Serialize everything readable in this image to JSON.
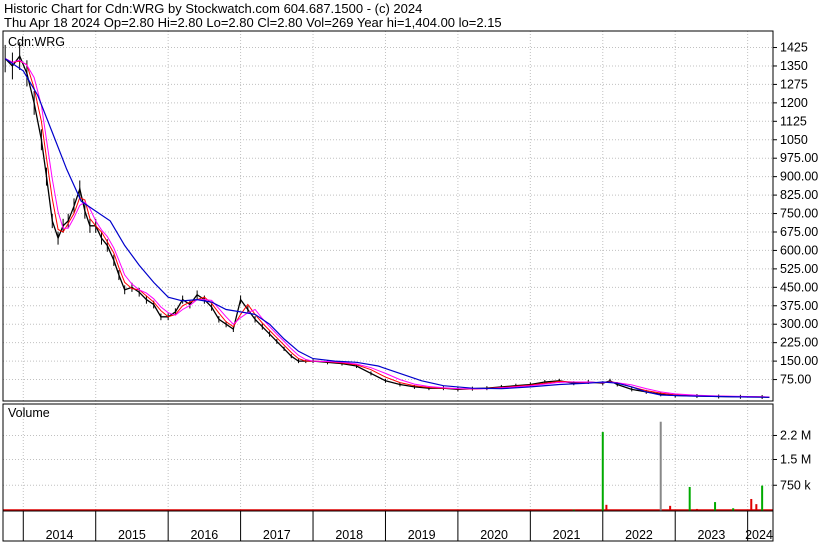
{
  "header": {
    "line1": "Historic Chart for Cdn:WRG by Stockwatch.com 604.687.1500 - (c) 2024",
    "line2": "Thu Apr 18 2024  Op=2.80  Hi=2.80  Lo=2.80  Cl=2.80  Vol=269  Year hi=1,404.00  lo=2.15"
  },
  "colors": {
    "price": "#000000",
    "ma_short": "#ff0000",
    "ma_mid": "#ff00ff",
    "ma_long": "#0000cc",
    "grid": "#c0c0c0",
    "vol_up": "#00aa00",
    "vol_down": "#dd0000",
    "vol_flat": "#888888"
  },
  "chart_data": [
    {
      "type": "line",
      "panel_label": "Cdn:WRG",
      "y_ticks": [
        "1425",
        "1350",
        "1275",
        "1200",
        "1125",
        "1050",
        "975.00",
        "900.00",
        "825.00",
        "750.00",
        "675.00",
        "600.00",
        "525.00",
        "450.00",
        "375.00",
        "300.00",
        "225.00",
        "150.00",
        "75.00"
      ],
      "ylim": [
        0,
        1480
      ],
      "xlim": [
        2013.72,
        2024.35
      ],
      "x_labels": [
        "2014",
        "2015",
        "2016",
        "2017",
        "2018",
        "2019",
        "2020",
        "2021",
        "2022",
        "2023",
        "2024"
      ],
      "series": [
        {
          "role": "price",
          "x": [
            2013.75,
            2013.85,
            2013.95,
            2014.05,
            2014.15,
            2014.25,
            2014.32,
            2014.4,
            2014.48,
            2014.55,
            2014.62,
            2014.7,
            2014.78,
            2014.85,
            2014.92,
            2015.0,
            2015.08,
            2015.16,
            2015.25,
            2015.32,
            2015.4,
            2015.5,
            2015.6,
            2015.7,
            2015.8,
            2015.9,
            2016.0,
            2016.1,
            2016.2,
            2016.3,
            2016.4,
            2016.5,
            2016.6,
            2016.7,
            2016.8,
            2016.9,
            2017.0,
            2017.1,
            2017.2,
            2017.3,
            2017.4,
            2017.5,
            2017.6,
            2017.7,
            2017.8,
            2017.9,
            2018.0,
            2018.2,
            2018.4,
            2018.6,
            2018.8,
            2019.0,
            2019.2,
            2019.4,
            2019.6,
            2019.8,
            2020.0,
            2020.2,
            2020.4,
            2020.6,
            2020.8,
            2021.0,
            2021.2,
            2021.4,
            2021.6,
            2021.8,
            2022.0,
            2022.1,
            2022.2,
            2022.4,
            2022.6,
            2022.8,
            2023.0,
            2023.3,
            2023.6,
            2023.9,
            2024.2,
            2024.3
          ],
          "y": [
            1380,
            1350,
            1390,
            1320,
            1200,
            1050,
            900,
            720,
            650,
            700,
            720,
            780,
            850,
            760,
            700,
            700,
            650,
            620,
            560,
            500,
            440,
            450,
            430,
            400,
            380,
            330,
            330,
            350,
            400,
            380,
            420,
            400,
            370,
            320,
            300,
            280,
            400,
            360,
            320,
            290,
            260,
            230,
            200,
            170,
            150,
            150,
            150,
            145,
            140,
            130,
            100,
            70,
            55,
            45,
            40,
            40,
            35,
            38,
            40,
            45,
            50,
            55,
            65,
            70,
            60,
            65,
            60,
            70,
            55,
            35,
            25,
            15,
            10,
            8,
            6,
            5,
            4,
            3
          ]
        },
        {
          "role": "ma_long",
          "x": [
            2013.75,
            2014.0,
            2014.2,
            2014.4,
            2014.6,
            2014.8,
            2015.0,
            2015.2,
            2015.4,
            2015.6,
            2015.8,
            2016.0,
            2016.2,
            2016.4,
            2016.6,
            2016.8,
            2017.0,
            2017.2,
            2017.4,
            2017.6,
            2017.8,
            2018.0,
            2018.3,
            2018.6,
            2018.9,
            2019.2,
            2019.5,
            2019.8,
            2020.2,
            2020.6,
            2021.0,
            2021.4,
            2021.8,
            2022.0,
            2022.2,
            2022.4,
            2022.6,
            2022.8,
            2023.2,
            2023.6,
            2024.0,
            2024.3
          ],
          "y": [
            1380,
            1330,
            1230,
            1080,
            930,
            800,
            760,
            720,
            620,
            540,
            470,
            410,
            395,
            400,
            390,
            360,
            350,
            340,
            300,
            240,
            190,
            160,
            150,
            145,
            130,
            100,
            70,
            50,
            40,
            38,
            45,
            55,
            60,
            65,
            60,
            45,
            25,
            12,
            8,
            6,
            4,
            3
          ]
        }
      ]
    },
    {
      "type": "bar",
      "panel_label": "Volume",
      "y_ticks": [
        "2.2 M",
        "1.5 M",
        "750 k"
      ],
      "ylim": [
        0,
        3000000
      ],
      "bars": [
        {
          "x": 2022.0,
          "value": 2300000,
          "dir": "up"
        },
        {
          "x": 2022.05,
          "value": 180000,
          "dir": "down"
        },
        {
          "x": 2022.8,
          "value": 2600000,
          "dir": "flat"
        },
        {
          "x": 2022.93,
          "value": 150000,
          "dir": "down"
        },
        {
          "x": 2023.2,
          "value": 700000,
          "dir": "up"
        },
        {
          "x": 2023.55,
          "value": 260000,
          "dir": "up"
        },
        {
          "x": 2024.05,
          "value": 350000,
          "dir": "down"
        },
        {
          "x": 2024.12,
          "value": 200000,
          "dir": "down"
        },
        {
          "x": 2024.2,
          "value": 740000,
          "dir": "up"
        },
        {
          "x": 2023.3,
          "value": 60000,
          "dir": "down"
        },
        {
          "x": 2023.8,
          "value": 80000,
          "dir": "up"
        },
        {
          "x": 2021.6,
          "value": 40000,
          "dir": "up"
        },
        {
          "x": 2021.2,
          "value": 30000,
          "dir": "down"
        }
      ]
    }
  ]
}
